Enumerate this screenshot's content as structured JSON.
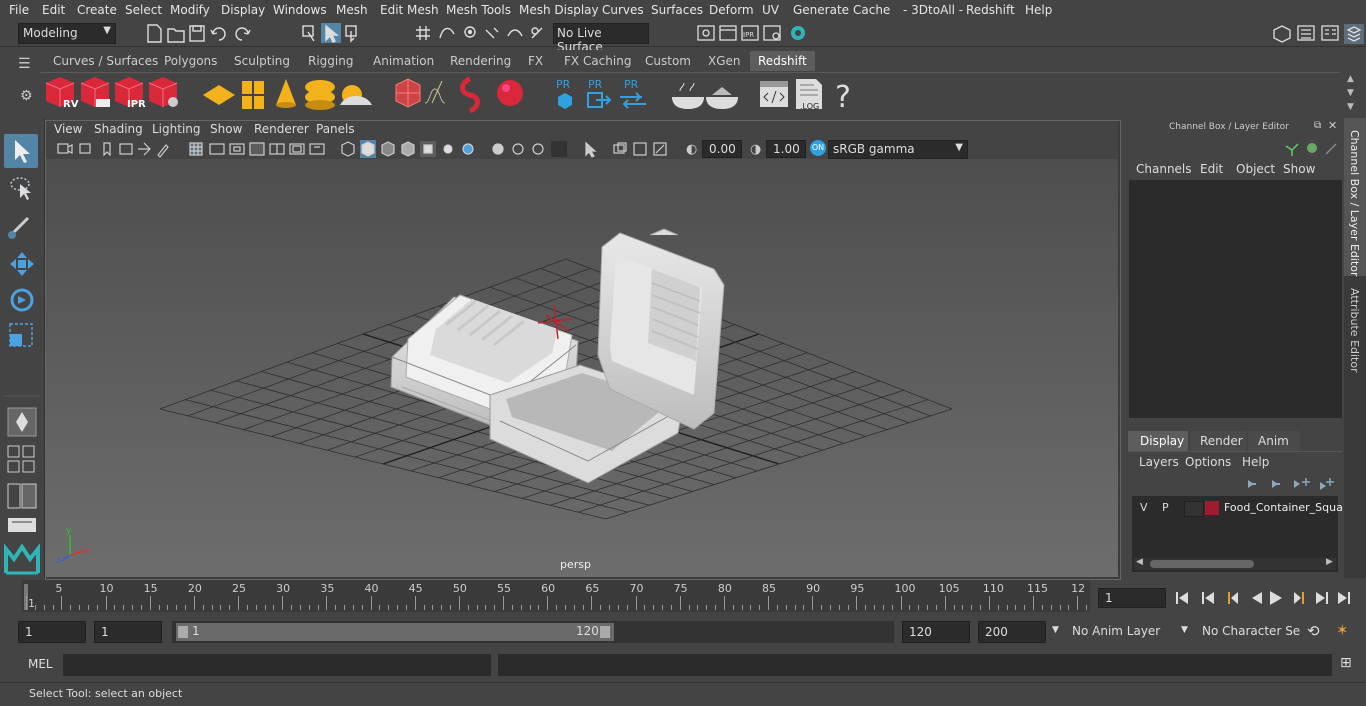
{
  "menubar": {
    "items": [
      "File",
      "Edit",
      "Create",
      "Select",
      "Modify",
      "Display",
      "Windows",
      "Mesh",
      "Edit Mesh",
      "Mesh Tools",
      "Mesh Display",
      "Curves",
      "Surfaces",
      "Deform",
      "UV",
      "Generate",
      "Cache",
      "- 3DtoAll -",
      "Redshift",
      "Help"
    ]
  },
  "statusline": {
    "mode": "Modeling",
    "live_surface": "No Live Surface"
  },
  "shelf": {
    "tabs": [
      "Curves / Surfaces",
      "Polygons",
      "Sculpting",
      "Rigging",
      "Animation",
      "Rendering",
      "FX",
      "FX Caching",
      "Custom",
      "XGen",
      "Redshift"
    ],
    "active_tab": "Redshift",
    "icon_labels": {
      "rv": "RV",
      "ipr": "IPR",
      "pr1": "PR",
      "pr2": "PR",
      "pr3": "PR",
      "log": ".LOG",
      "help": "?"
    }
  },
  "viewport": {
    "menus": [
      "View",
      "Shading",
      "Lighting",
      "Show",
      "Renderer",
      "Panels"
    ],
    "exposure": "0.00",
    "gamma": "1.00",
    "colorspace": "sRGB gamma",
    "camera_label": "persp",
    "axis": {
      "x": "x",
      "y": "y",
      "z": "z"
    }
  },
  "channelbox": {
    "title": "Channel Box / Layer Editor",
    "menus": [
      "Channels",
      "Edit",
      "Object",
      "Show"
    ]
  },
  "layereditor": {
    "tabs": [
      "Display",
      "Render",
      "Anim"
    ],
    "active_tab": "Display",
    "menus": [
      "Layers",
      "Options",
      "Help"
    ],
    "layer": {
      "v": "V",
      "p": "P",
      "name": "Food_Container_Squa",
      "color": "#a01a30"
    }
  },
  "sidetabs": {
    "channel_box": "Channel Box / Layer Editor",
    "attribute_editor": "Attribute Editor"
  },
  "timeline": {
    "ticks": [
      "1",
      "5",
      "10",
      "15",
      "20",
      "25",
      "30",
      "35",
      "40",
      "45",
      "50",
      "55",
      "60",
      "65",
      "70",
      "75",
      "80",
      "85",
      "90",
      "95",
      "100",
      "105",
      "110",
      "115",
      "12"
    ],
    "current_frame": "1"
  },
  "range": {
    "start": "1",
    "playback_start": "1",
    "slider_start": "1",
    "slider_end": "120",
    "playback_end": "120",
    "end": "200",
    "anim_layer": "No Anim Layer",
    "character_set": "No Character Set"
  },
  "cmdline": {
    "label": "MEL"
  },
  "helpline": {
    "text": "Select Tool: select an object"
  },
  "colors": {
    "active_tool": "#5285a6",
    "maya_logo": "#2fb4b8"
  }
}
